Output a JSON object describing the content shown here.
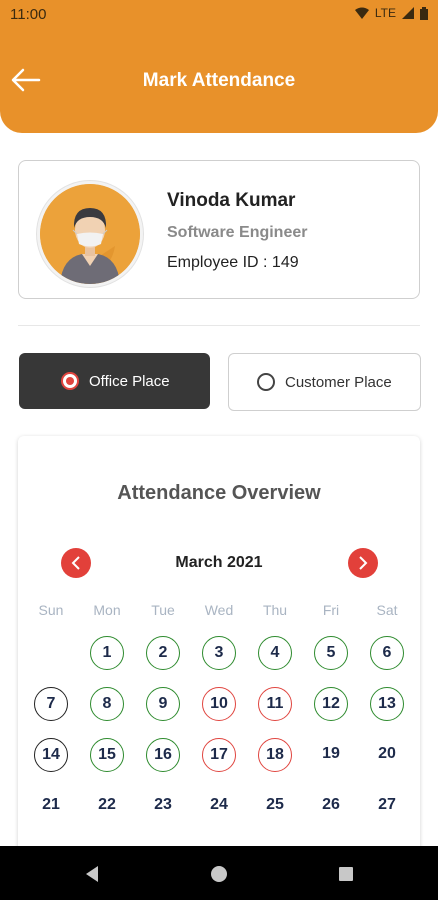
{
  "status_bar": {
    "time": "11:00",
    "network": "LTE"
  },
  "header": {
    "title": "Mark Attendance"
  },
  "employee": {
    "name": "Vinoda Kumar",
    "role": "Software Engineer",
    "id_text": "Employee ID : 149"
  },
  "work_location": {
    "options": [
      "Office Place",
      "Customer Place"
    ],
    "selected": "Office Place"
  },
  "calendar": {
    "title": "Attendance Overview",
    "month": "March 2021",
    "weekdays": [
      "Sun",
      "Mon",
      "Tue",
      "Wed",
      "Thu",
      "Fri",
      "Sat"
    ],
    "days": {
      "1": "1",
      "2": "2",
      "3": "3",
      "4": "4",
      "5": "5",
      "6": "6",
      "7": "7",
      "8": "8",
      "9": "9",
      "10": "10",
      "11": "11",
      "12": "12",
      "13": "13",
      "14": "14",
      "15": "15",
      "16": "16",
      "17": "17",
      "18": "18",
      "19": "19",
      "20": "20",
      "21": "21",
      "22": "22",
      "23": "23",
      "24": "24",
      "25": "25",
      "26": "26",
      "27": "27"
    },
    "colors": {
      "present": "#2e8b2e",
      "absent": "#e0453f",
      "holiday": "#222222",
      "accent": "#e8912a"
    }
  }
}
